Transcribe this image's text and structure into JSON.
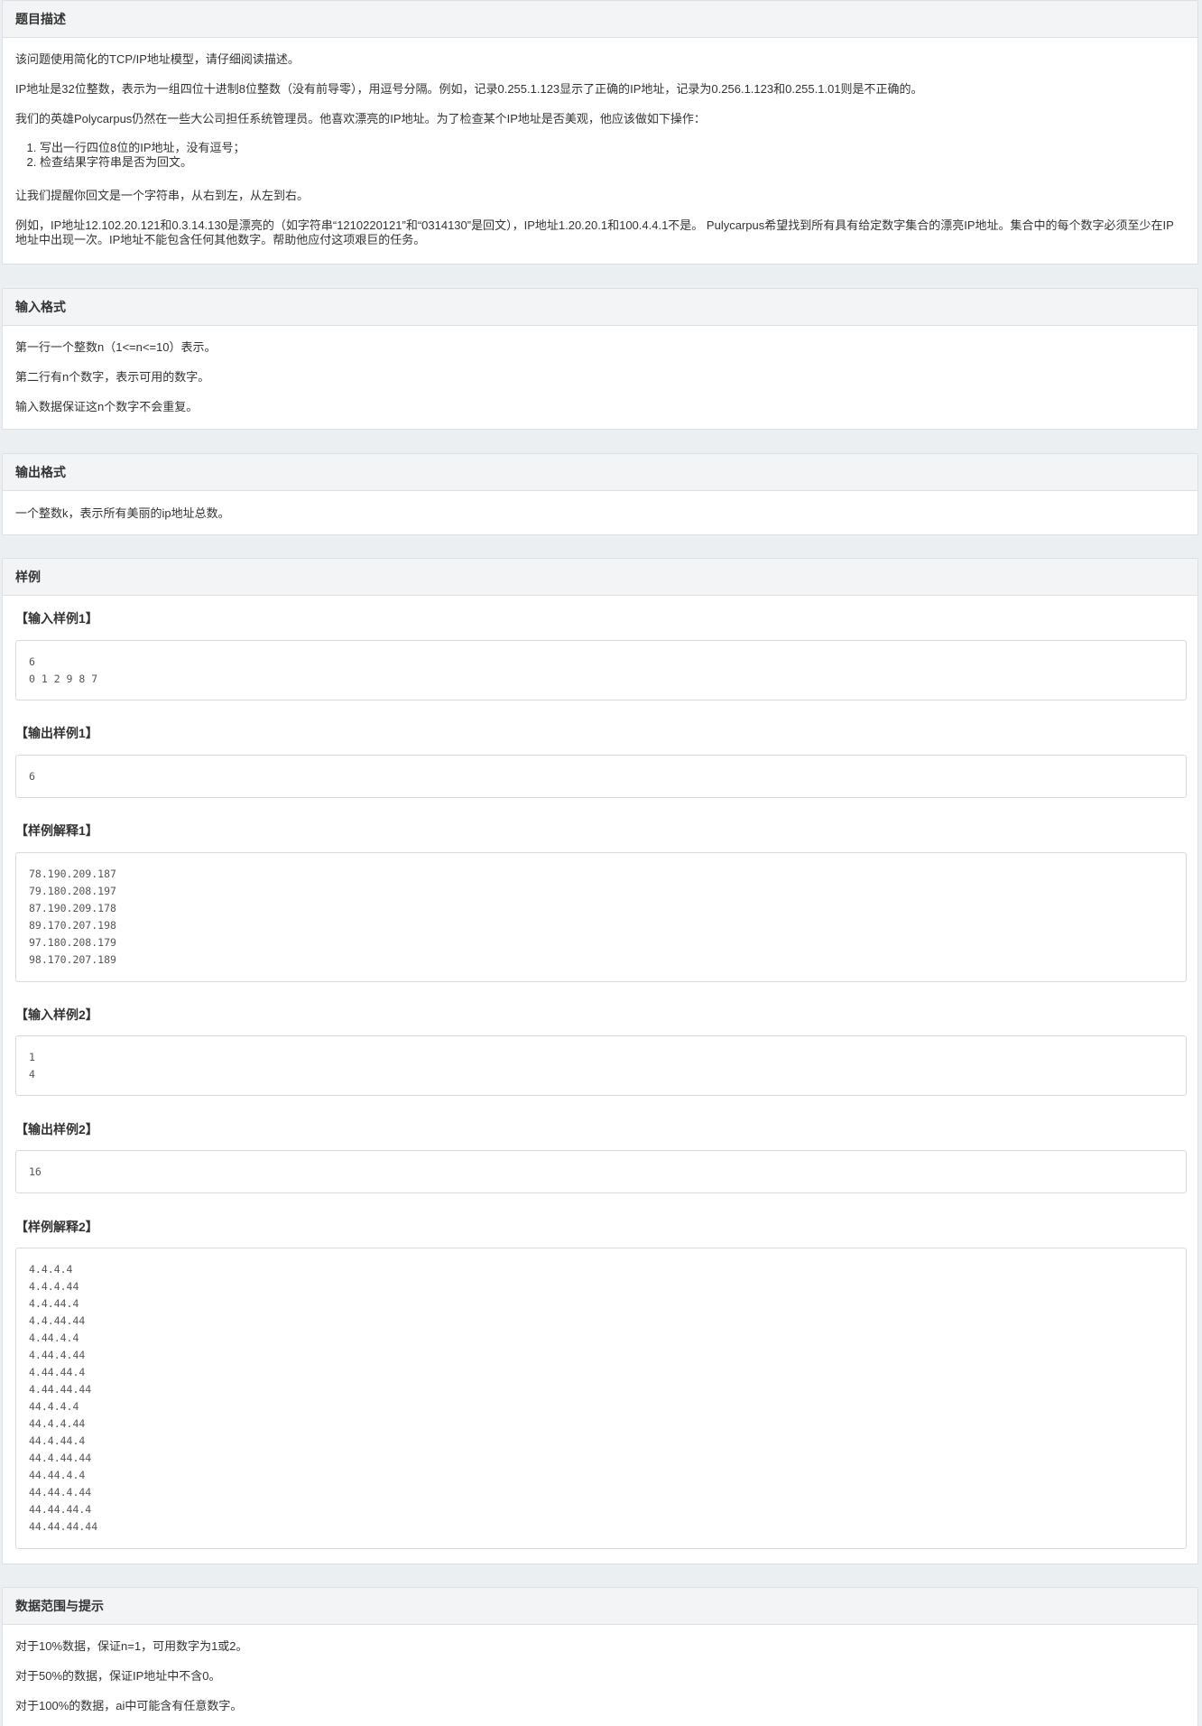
{
  "description": {
    "heading": "题目描述",
    "p1": "该问题使用简化的TCP/IP地址模型，请仔细阅读描述。",
    "p2": "IP地址是32位整数，表示为一组四位十进制8位整数（没有前导零），用逗号分隔。例如，记录0.255.1.123显示了正确的IP地址，记录为0.256.1.123和0.255.1.01则是不正确的。",
    "p3": "我们的英雄Polycarpus仍然在一些大公司担任系统管理员。他喜欢漂亮的IP地址。为了检查某个IP地址是否美观，他应该做如下操作：",
    "steps": [
      "写出一行四位8位的IP地址，没有逗号；",
      "检查结果字符串是否为回文。"
    ],
    "p4": "让我们提醒你回文是一个字符串，从右到左，从左到右。",
    "p5": "例如，IP地址12.102.20.121和0.3.14.130是漂亮的（如字符串“1210220121”和“0314130”是回文），IP地址1.20.20.1和100.4.4.1不是。 Pulycarpus希望找到所有具有给定数字集合的漂亮IP地址。集合中的每个数字必须至少在IP地址中出现一次。IP地址不能包含任何其他数字。帮助他应付这项艰巨的任务。"
  },
  "input_format": {
    "heading": "输入格式",
    "lines": [
      "第一行一个整数n（1<=n<=10）表示。",
      "第二行有n个数字，表示可用的数字。",
      "输入数据保证这n个数字不会重复。"
    ]
  },
  "output_format": {
    "heading": "输出格式",
    "text": "一个整数k，表示所有美丽的ip地址总数。"
  },
  "samples": {
    "heading": "样例",
    "input1_title": "【输入样例1】",
    "input1": [
      "6",
      "0 1 2 9 8 7"
    ],
    "output1_title": "【输出样例1】",
    "output1": [
      "6"
    ],
    "explain1_title": "【样例解释1】",
    "explain1": [
      "78.190.209.187",
      "79.180.208.197",
      "87.190.209.178",
      "89.170.207.198",
      "97.180.208.179",
      "98.170.207.189"
    ],
    "input2_title": "【输入样例2】",
    "input2": [
      "1",
      "4"
    ],
    "output2_title": "【输出样例2】",
    "output2": [
      "16"
    ],
    "explain2_title": "【样例解释2】",
    "explain2": [
      "4.4.4.4",
      "4.4.4.44",
      "4.4.44.4",
      "4.4.44.44",
      "4.44.4.4",
      "4.44.4.44",
      "4.44.44.4",
      "4.44.44.44",
      "44.4.4.4",
      "44.4.4.44",
      "44.4.44.4",
      "44.4.44.44",
      "44.44.4.4",
      "44.44.4.44",
      "44.44.44.4",
      "44.44.44.44"
    ]
  },
  "hints": {
    "heading": "数据范围与提示",
    "lines": [
      "对于10%数据，保证n=1，可用数字为1或2。",
      "对于50%的数据，保证IP地址中不含0。",
      "对于100%的数据，ai中可能含有任意数字。"
    ]
  }
}
